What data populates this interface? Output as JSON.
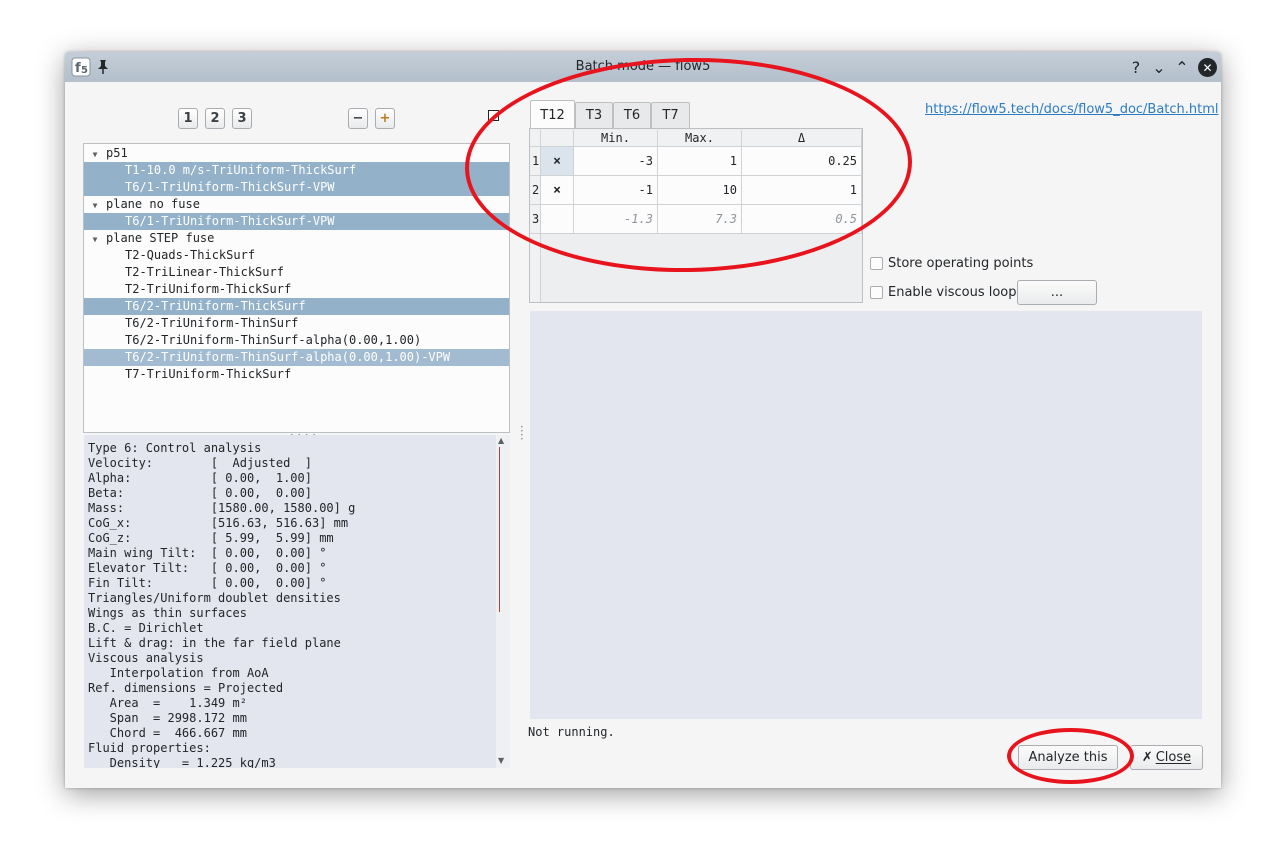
{
  "window": {
    "title": "Batch mode — flow5",
    "titlebar_buttons": [
      "?",
      "⌄",
      "⌃",
      "✕"
    ]
  },
  "toolbar": {
    "num_buttons": [
      "1",
      "2",
      "3"
    ],
    "collapse_label": "−",
    "expand_label": "+"
  },
  "tree": {
    "rows": [
      {
        "label": "p51",
        "level": 0,
        "selected": false
      },
      {
        "label": "T1-10.0 m/s-TriUniform-ThickSurf",
        "level": 1,
        "selected": true
      },
      {
        "label": "T6/1-TriUniform-ThickSurf-VPW",
        "level": 1,
        "selected": true
      },
      {
        "label": "plane no fuse",
        "level": 0,
        "selected": false
      },
      {
        "label": "T6/1-TriUniform-ThickSurf-VPW",
        "level": 1,
        "selected": true
      },
      {
        "label": "plane STEP fuse",
        "level": 0,
        "selected": false
      },
      {
        "label": "T2-Quads-ThickSurf",
        "level": 1,
        "selected": false
      },
      {
        "label": "T2-TriLinear-ThickSurf",
        "level": 1,
        "selected": false
      },
      {
        "label": "T2-TriUniform-ThickSurf",
        "level": 1,
        "selected": false
      },
      {
        "label": "T6/2-TriUniform-ThickSurf",
        "level": 1,
        "selected": true
      },
      {
        "label": "T6/2-TriUniform-ThinSurf",
        "level": 1,
        "selected": false
      },
      {
        "label": "T6/2-TriUniform-ThinSurf-alpha(0.00,1.00)",
        "level": 1,
        "selected": false
      },
      {
        "label": "T6/2-TriUniform-ThinSurf-alpha(0.00,1.00)-VPW",
        "level": 1,
        "selected": true
      },
      {
        "label": "T7-TriUniform-ThickSurf",
        "level": 1,
        "selected": false
      }
    ]
  },
  "details": {
    "lines": [
      "Type 6: Control analysis",
      "Velocity:        [  Adjusted  ]",
      "Alpha:           [ 0.00,  1.00]",
      "Beta:            [ 0.00,  0.00]",
      "Mass:            [1580.00, 1580.00] g",
      "CoG_x:           [516.63, 516.63] mm",
      "CoG_z:           [ 5.99,  5.99] mm",
      "Main wing Tilt:  [ 0.00,  0.00] °",
      "Elevator Tilt:   [ 0.00,  0.00] °",
      "Fin Tilt:        [ 0.00,  0.00] °",
      "Triangles/Uniform doublet densities",
      "Wings as thin surfaces",
      "B.C. = Dirichlet",
      "Lift & drag: in the far field plane",
      "Viscous analysis",
      "   Interpolation from AoA",
      "Ref. dimensions = Projected",
      "   Area  =    1.349 m²",
      "   Span  = 2998.172 mm",
      "   Chord =  466.667 mm",
      "Fluid properties:",
      "   Density   = 1.225 kg/m3"
    ]
  },
  "tabs": [
    {
      "label": "T12",
      "active": true
    },
    {
      "label": "T3",
      "active": false
    },
    {
      "label": "T6",
      "active": false
    },
    {
      "label": "T7",
      "active": false
    }
  ],
  "range_table": {
    "headers": [
      "Min.",
      "Max.",
      "Δ"
    ],
    "rows": [
      {
        "index": "1",
        "active": "×",
        "min": "-3",
        "max": "1",
        "delta": "0.25"
      },
      {
        "index": "2",
        "active": "×",
        "min": "-1",
        "max": "10",
        "delta": "1"
      },
      {
        "index": "3",
        "active": "",
        "min": "-1.3",
        "max": "7.3",
        "delta": "0.5"
      }
    ]
  },
  "link": {
    "text": "https://flow5.tech/docs/flow5_doc/Batch.html"
  },
  "options": {
    "store_op_points": "Store operating points",
    "enable_viscous": "Enable viscous loop",
    "viscous_settings": "..."
  },
  "status": {
    "text": "Not running."
  },
  "actions": {
    "analyze_label": "Analyze this",
    "close_label": "Close"
  },
  "colors": {
    "selection": "#93b2ca",
    "annotation_ring": "#e8141d",
    "link": "#2d7cc2"
  }
}
